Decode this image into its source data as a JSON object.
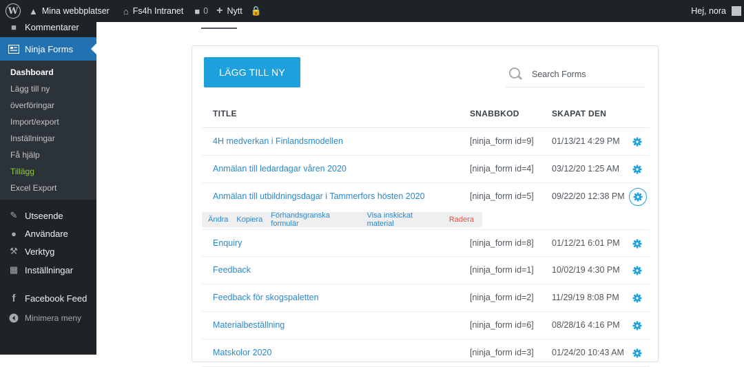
{
  "adminbar": {
    "sites": "Mina webbplatser",
    "site_name": "Fs4h Intranet",
    "comments_count": "0",
    "new_label": "Nytt",
    "greeting": "Hej, nora"
  },
  "sidebar": {
    "comments": "Kommentarer",
    "ninja_forms": "Ninja Forms",
    "submenu": [
      "Dashboard",
      "Lägg till ny",
      "överföringar",
      "Import/export",
      "Inställningar",
      "Få hjälp",
      "Tillägg",
      "Excel Export"
    ],
    "appearance": "Utseende",
    "users": "Användare",
    "tools": "Verktyg",
    "settings": "Inställningar",
    "facebook_feed": "Facebook Feed",
    "collapse": "Minimera meny"
  },
  "main": {
    "add_button": "LÄGG TILL NY",
    "search_placeholder": "Search Forms",
    "columns": {
      "title": "TITLE",
      "shortcode": "SNABBKOD",
      "created": "SKAPAT DEN"
    },
    "rows": [
      {
        "title": "4H medverkan i Finlandsmodellen",
        "shortcode": "[ninja_form id=9]",
        "date": "01/13/21 4:29 PM"
      },
      {
        "title": "Anmälan till ledardagar våren 2020",
        "shortcode": "[ninja_form id=4]",
        "date": "03/12/20 1:25 AM"
      },
      {
        "title": "Anmälan till utbildningsdagar i Tammerfors hösten 2020",
        "shortcode": "[ninja_form id=5]",
        "date": "09/22/20 12:38 PM"
      },
      {
        "title": "Enquiry",
        "shortcode": "[ninja_form id=8]",
        "date": "01/12/21 6:01 PM"
      },
      {
        "title": "Feedback",
        "shortcode": "[ninja_form id=1]",
        "date": "10/02/19 4:30 PM"
      },
      {
        "title": "Feedback för skogspaletten",
        "shortcode": "[ninja_form id=2]",
        "date": "11/29/19 8:08 PM"
      },
      {
        "title": "Materialbeställning",
        "shortcode": "[ninja_form id=6]",
        "date": "08/28/16 4:16 PM"
      },
      {
        "title": "Matskolor 2020",
        "shortcode": "[ninja_form id=3]",
        "date": "01/24/20 10:43 AM"
      }
    ],
    "row_actions": [
      "Ändra",
      "Kopiera",
      "Förhandsgranska formulär",
      "Visa inskickat material",
      "Radera"
    ]
  },
  "colors": {
    "accent": "#1ea0dc",
    "link": "#2a88c9",
    "sidebar_bg": "#1d2327",
    "current_menu": "#2271b1",
    "addon_highlight": "#8fcb3f",
    "delete": "#e2504b"
  },
  "icons": [
    "wordpress-icon",
    "sites-icon",
    "home-icon",
    "comment-icon",
    "plus-icon",
    "lock-icon",
    "forms-icon",
    "brush-icon",
    "users-icon",
    "wrench-icon",
    "settings-icon",
    "facebook-icon",
    "collapse-icon",
    "search-icon",
    "gear-icon"
  ]
}
